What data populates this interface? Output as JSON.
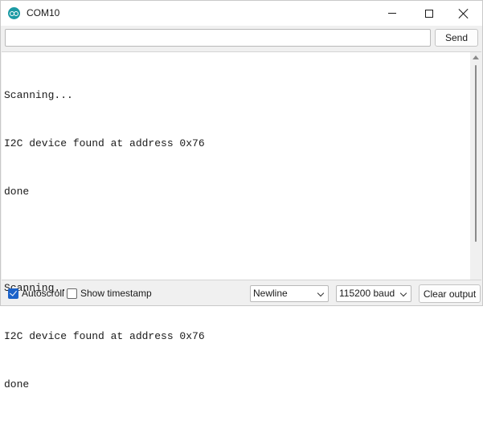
{
  "window": {
    "title": "COM10",
    "app_icon": "arduino-icon"
  },
  "send_row": {
    "input_value": "",
    "send_label": "Send"
  },
  "output": {
    "lines": [
      "Scanning...",
      "I2C device found at address 0x76",
      "done",
      "",
      "Scanning...",
      "I2C device found at address 0x76",
      "done"
    ]
  },
  "bottom": {
    "autoscroll_label": "Autoscroll",
    "autoscroll_checked": true,
    "timestamp_label": "Show timestamp",
    "timestamp_checked": false,
    "line_ending": "Newline",
    "baud_rate": "115200 baud",
    "clear_label": "Clear output"
  },
  "colors": {
    "accent": "#1b62c9",
    "app_icon": "#1b9aa4"
  }
}
